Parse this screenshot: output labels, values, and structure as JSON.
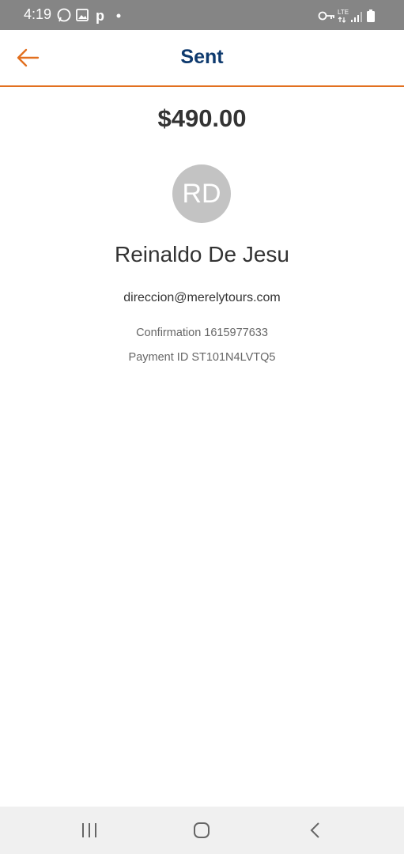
{
  "status_bar": {
    "time": "4:19",
    "left_icons": [
      "whatsapp-icon",
      "gallery-icon",
      "p-icon",
      "dot-icon"
    ],
    "right_icons": [
      "vpn-key-icon",
      "lte-icon",
      "signal-icon",
      "battery-icon"
    ],
    "network": "LTE"
  },
  "header": {
    "title": "Sent",
    "back_icon": "arrow-left-icon",
    "accent_color": "#e2701f",
    "title_color": "#0e3a6e"
  },
  "payment": {
    "amount": "$490.00",
    "avatar_initials": "RD",
    "recipient_name": "Reinaldo De Jesu",
    "email": "direccion@merelytours.com",
    "confirmation": "Confirmation 1615977633",
    "payment_id": "Payment ID ST101N4LVTQ5"
  },
  "nav_bar": {
    "buttons": [
      "recent-apps-icon",
      "home-icon",
      "back-icon"
    ]
  }
}
